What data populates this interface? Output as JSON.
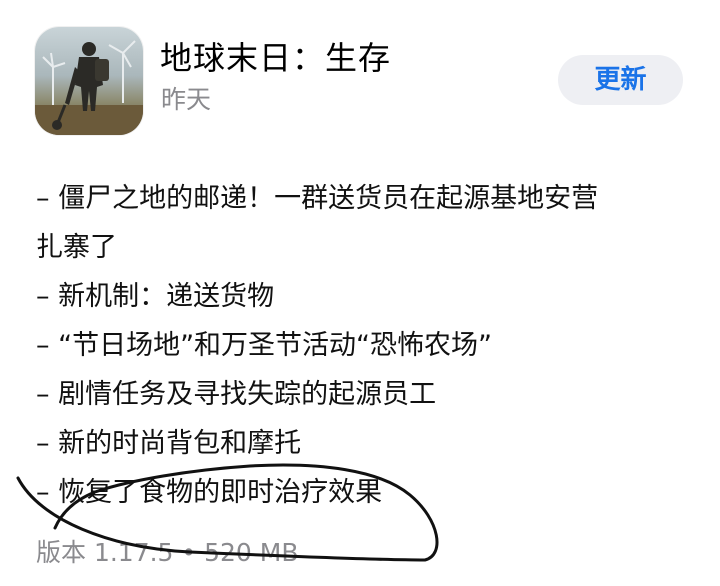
{
  "app": {
    "name": "地球末日：生存",
    "date": "昨天",
    "update_label": "更新"
  },
  "release_notes": {
    "lines": [
      "– 僵尸之地的邮递！一群送货员在起源基地安营",
      "扎寨了",
      "– 新机制：递送货物",
      "– “节日场地”和万圣节活动“恐怖农场”",
      "– 剧情任务及寻找失踪的起源员工",
      "– 新的时尚背包和摩托",
      "– 恢复了食物的即时治疗效果"
    ]
  },
  "version_info": "版本 1.17.5 • 520 MB",
  "colors": {
    "accent": "#1a73e8",
    "secondary_text": "#8a8a8e",
    "button_bg": "#eeeff3"
  }
}
